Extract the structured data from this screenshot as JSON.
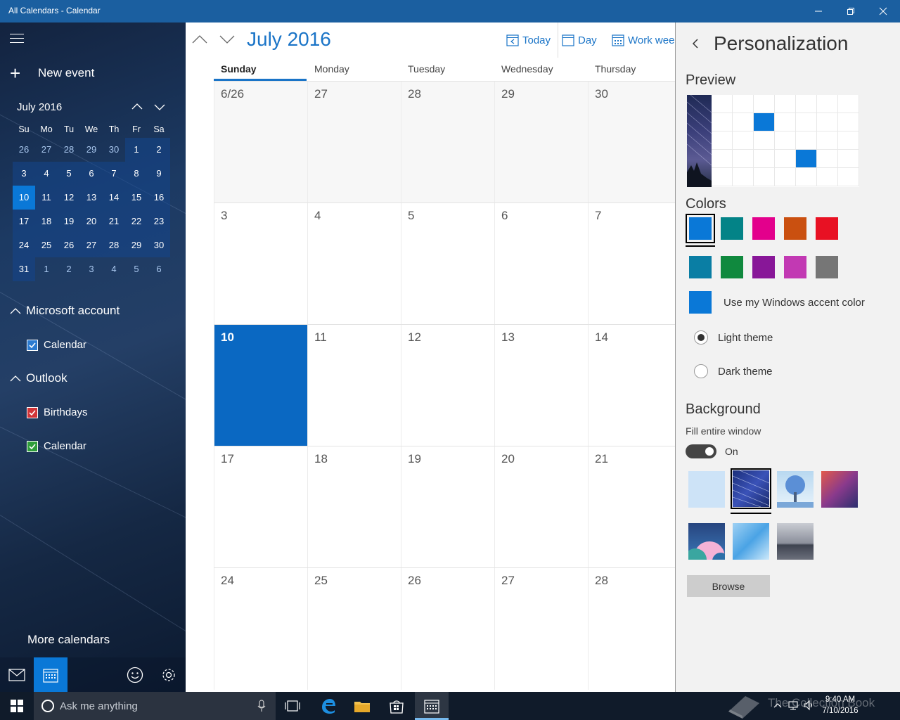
{
  "window": {
    "title": "All Calendars - Calendar"
  },
  "sidebar": {
    "new_event_label": "New event",
    "mini_calendar": {
      "title": "July 2016",
      "weekday_labels": [
        "Su",
        "Mo",
        "Tu",
        "We",
        "Th",
        "Fr",
        "Sa"
      ],
      "weeks": [
        [
          "26",
          "27",
          "28",
          "29",
          "30",
          "1",
          "2"
        ],
        [
          "3",
          "4",
          "5",
          "6",
          "7",
          "8",
          "9"
        ],
        [
          "10",
          "11",
          "12",
          "13",
          "14",
          "15",
          "16"
        ],
        [
          "17",
          "18",
          "19",
          "20",
          "21",
          "22",
          "23"
        ],
        [
          "24",
          "25",
          "26",
          "27",
          "28",
          "29",
          "30"
        ],
        [
          "31",
          "1",
          "2",
          "3",
          "4",
          "5",
          "6"
        ]
      ]
    },
    "accounts": [
      {
        "name": "Microsoft account",
        "calendars": [
          {
            "label": "Calendar",
            "color": "#2b7bd1"
          }
        ]
      },
      {
        "name": "Outlook",
        "calendars": [
          {
            "label": "Birthdays",
            "color": "#d13438"
          },
          {
            "label": "Calendar",
            "color": "#2e9d3a"
          }
        ]
      }
    ],
    "more_calendars_label": "More calendars"
  },
  "main": {
    "month_title": "July 2016",
    "toolbar": {
      "today_label": "Today",
      "day_label": "Day",
      "work_week_label": "Work week"
    },
    "weekday_headers": [
      "Sunday",
      "Monday",
      "Tuesday",
      "Wednesday",
      "Thursday"
    ],
    "weeks": [
      [
        "6/26",
        "27",
        "28",
        "29",
        "30"
      ],
      [
        "3",
        "4",
        "5",
        "6",
        "7"
      ],
      [
        "10",
        "11",
        "12",
        "13",
        "14"
      ],
      [
        "17",
        "18",
        "19",
        "20",
        "21"
      ],
      [
        "24",
        "25",
        "26",
        "27",
        "28"
      ]
    ]
  },
  "panel": {
    "title": "Personalization",
    "preview_heading": "Preview",
    "colors_heading": "Colors",
    "colors": [
      "#0a78d7",
      "#038387",
      "#e3008c",
      "#ca5010",
      "#e81123",
      "#0a7ea4",
      "#10893e",
      "#881798",
      "#c239b3",
      "#767676"
    ],
    "accent_color_label": "Use my Windows accent color",
    "accent_color": "#0a78d7",
    "light_theme_label": "Light theme",
    "dark_theme_label": "Dark theme",
    "background_heading": "Background",
    "fill_window_label": "Fill entire window",
    "fill_window_state": "On",
    "browse_label": "Browse"
  },
  "taskbar": {
    "search_placeholder": "Ask me anything",
    "time": "9:40 AM",
    "date": "7/10/2016",
    "watermark": "The Collection Book"
  }
}
